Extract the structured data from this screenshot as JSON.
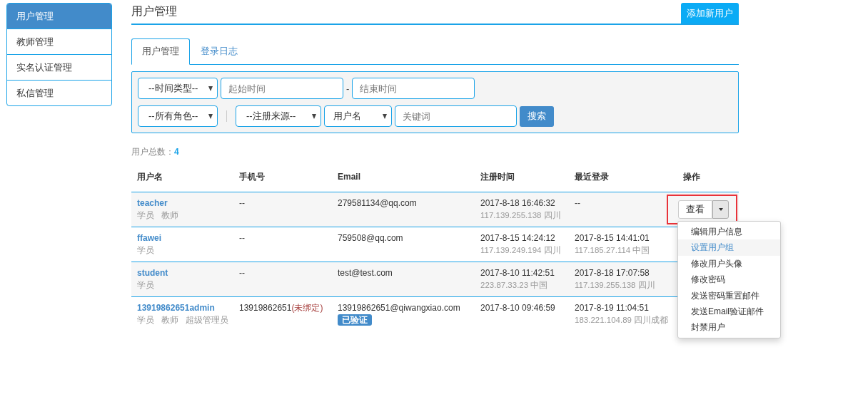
{
  "sidebar": {
    "items": [
      {
        "label": "用户管理",
        "selected": true
      },
      {
        "label": "教师管理",
        "selected": false
      },
      {
        "label": "实名认证管理",
        "selected": false
      },
      {
        "label": "私信管理",
        "selected": false
      }
    ]
  },
  "header": {
    "title": "用户管理",
    "add_button": "添加新用户"
  },
  "tabs": [
    {
      "label": "用户管理",
      "selected": true
    },
    {
      "label": "登录日志",
      "selected": false
    }
  ],
  "filters": [
    [
      {
        "kind": "select",
        "value": "--时间类型--"
      },
      {
        "kind": "input",
        "placeholder": "起始时间"
      },
      {
        "kind": "text",
        "value": "-"
      },
      {
        "kind": "input",
        "placeholder": "结束时间"
      }
    ],
    [
      {
        "kind": "select",
        "value": "--所有角色--"
      },
      {
        "kind": "divider"
      },
      {
        "kind": "select",
        "value": "--注册来源--"
      },
      {
        "kind": "select",
        "value": "用户名"
      },
      {
        "kind": "input",
        "placeholder": "关键词"
      },
      {
        "kind": "button",
        "value": "搜索"
      }
    ]
  ],
  "count": {
    "label": "用户总数：",
    "value": "4"
  },
  "table": {
    "columns": [
      "用户名",
      "手机号",
      "Email",
      "注册时间",
      "最近登录",
      "操作"
    ],
    "rows": [
      {
        "username": "teacher",
        "roles": [
          "学员",
          "教师"
        ],
        "phone": "--",
        "email": "279581134@qq.com",
        "registered": "2017-8-18 16:46:32",
        "register_ip": "117.139.255.138 四川",
        "last_login": "--",
        "action": {
          "label": "查看",
          "highlighted": true
        }
      },
      {
        "username": "ffawei",
        "roles": [
          "学员"
        ],
        "phone": "--",
        "email": "759508@qq.com",
        "registered": "2017-8-15 14:24:12",
        "register_ip": "117.139.249.194 四川",
        "last_login": "2017-8-15 14:41:01",
        "login_ip": "117.185.27.114 中国"
      },
      {
        "username": "student",
        "roles": [
          "学员"
        ],
        "phone": "--",
        "email": "test@test.com",
        "registered": "2017-8-10 11:42:51",
        "register_ip": "223.87.33.23 中国",
        "last_login": "2017-8-18 17:07:58",
        "login_ip": "117.139.255.138 四川"
      },
      {
        "username": "13919862651admin",
        "roles": [
          "学员",
          "教师",
          "超级管理员"
        ],
        "phone": "13919862651",
        "phone_note": "(未绑定)",
        "email": "13919862651@qiwangxiao.com",
        "email_badge": "已验证",
        "registered": "2017-8-10 09:46:59",
        "last_login": "2017-8-19 11:04:51",
        "login_ip": "183.221.104.89 四川成都"
      }
    ]
  },
  "dropdown_menu": {
    "items": [
      {
        "label": "编辑用户信息",
        "selected": false
      },
      {
        "label": "设置用户组",
        "selected": true
      },
      {
        "label": "修改用户头像",
        "selected": false
      },
      {
        "label": "修改密码",
        "selected": false
      },
      {
        "label": "发送密码重置邮件",
        "selected": false
      },
      {
        "label": "发送Email验证邮件",
        "selected": false
      },
      {
        "label": "封禁用户",
        "selected": false
      }
    ]
  }
}
